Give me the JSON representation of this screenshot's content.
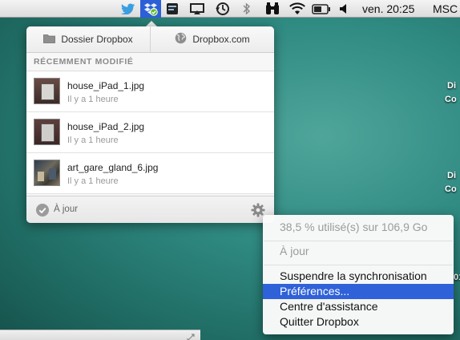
{
  "menubar": {
    "clock": "ven. 20:25",
    "user": "MSC",
    "icons": [
      "twitter-icon",
      "dropbox-icon",
      "terminal-icon",
      "airplay-icon",
      "time-machine-icon",
      "bluetooth-icon",
      "binoculars-icon",
      "wifi-icon",
      "battery-icon",
      "volume-icon"
    ]
  },
  "popup": {
    "open_folder_label": "Dossier Dropbox",
    "website_label": "Dropbox.com",
    "recent_header": "RÉCEMMENT MODIFIÉ",
    "files": [
      {
        "name": "house_iPad_1.jpg",
        "time": "Il y a 1 heure"
      },
      {
        "name": "house_iPad_2.jpg",
        "time": "Il y a 1 heure"
      },
      {
        "name": "art_gare_gland_6.jpg",
        "time": "Il y a 1 heure"
      }
    ],
    "status": "À jour"
  },
  "context_menu": {
    "usage": "38,5 % utilisé(s) sur 106,9 Go",
    "status": "À jour",
    "pause_sync": "Suspendre la synchronisation",
    "preferences": "Préférences...",
    "help_center": "Centre d'assistance",
    "quit": "Quitter Dropbox"
  },
  "desktop": {
    "labels": [
      "Di",
      "Co",
      "Di",
      "Co",
      "01"
    ]
  },
  "colors": {
    "menu_highlight": "#2f61d9",
    "desktop": "#2f8a82"
  }
}
